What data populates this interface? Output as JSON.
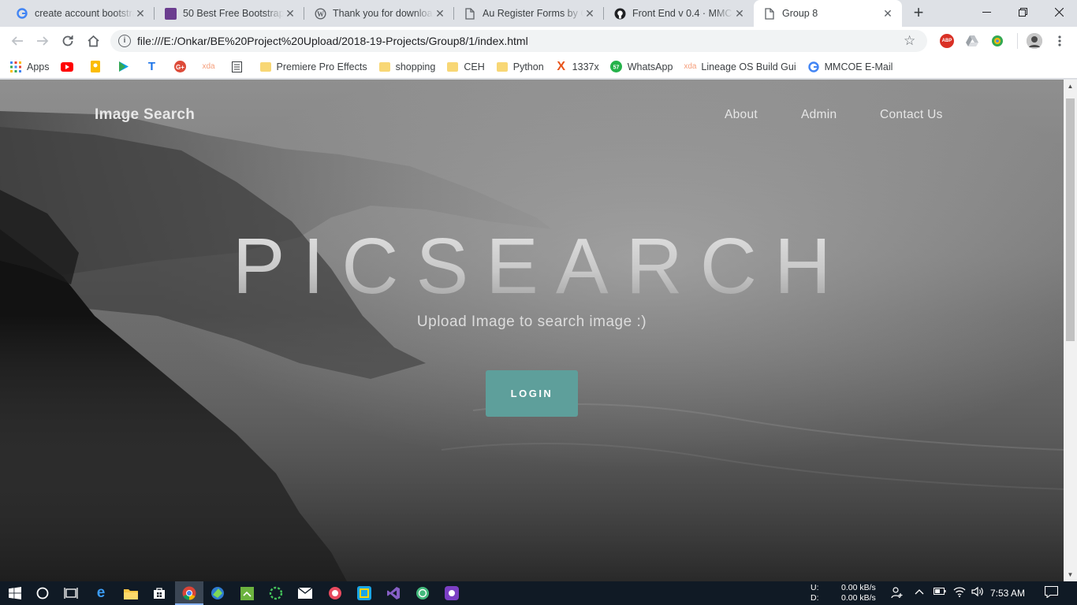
{
  "tabs": [
    {
      "title": "create account bootstra",
      "icon": "google-icon",
      "active": false
    },
    {
      "title": "50 Best Free Bootstrap",
      "icon": "colorlib-icon",
      "active": false
    },
    {
      "title": "Thank you for downloa",
      "icon": "wordpress-icon",
      "active": false
    },
    {
      "title": "Au Register Forms by C",
      "icon": "page-icon",
      "active": false
    },
    {
      "title": "Front End v 0.4 · MMCC",
      "icon": "github-icon",
      "active": false
    },
    {
      "title": "Group 8",
      "icon": "page-icon",
      "active": true
    }
  ],
  "toolbar": {
    "url": "file:///E:/Onkar/BE%20Project%20Upload/2018-19-Projects/Group8/1/index.html"
  },
  "bookmarks": [
    {
      "label": "Apps",
      "icon": "apps-grid-icon"
    },
    {
      "label": "",
      "icon": "youtube-icon"
    },
    {
      "label": "",
      "icon": "keep-icon"
    },
    {
      "label": "",
      "icon": "play-store-icon"
    },
    {
      "label": "",
      "icon": "t2-icon"
    },
    {
      "label": "",
      "icon": "google-plus-icon"
    },
    {
      "label": "",
      "icon": "xda-icon"
    },
    {
      "label": "",
      "icon": "docs-icon"
    },
    {
      "label": "Premiere Pro Effects",
      "icon": "folder-icon"
    },
    {
      "label": "shopping",
      "icon": "folder-icon"
    },
    {
      "label": "CEH",
      "icon": "folder-icon"
    },
    {
      "label": "Python",
      "icon": "folder-icon"
    },
    {
      "label": "1337x",
      "icon": "x-icon"
    },
    {
      "label": "WhatsApp",
      "icon": "whatsapp-icon"
    },
    {
      "label": "Lineage OS Build Gui",
      "icon": "xda-icon"
    },
    {
      "label": "MMCOE E-Mail",
      "icon": "google-icon"
    }
  ],
  "site": {
    "brand": "Image Search",
    "nav": [
      "About",
      "Admin",
      "Contact Us"
    ],
    "hero_title": "PICSEARCH",
    "hero_subtitle": "Upload Image to search image :)",
    "login_label": "LOGIN",
    "accent_color": "#5e9f9b"
  },
  "taskbar": {
    "net_up": "U:",
    "net_down": "D:",
    "up_rate": "0.00 kB/s",
    "down_rate": "0.00 kB/s",
    "time": "7:53 AM"
  }
}
